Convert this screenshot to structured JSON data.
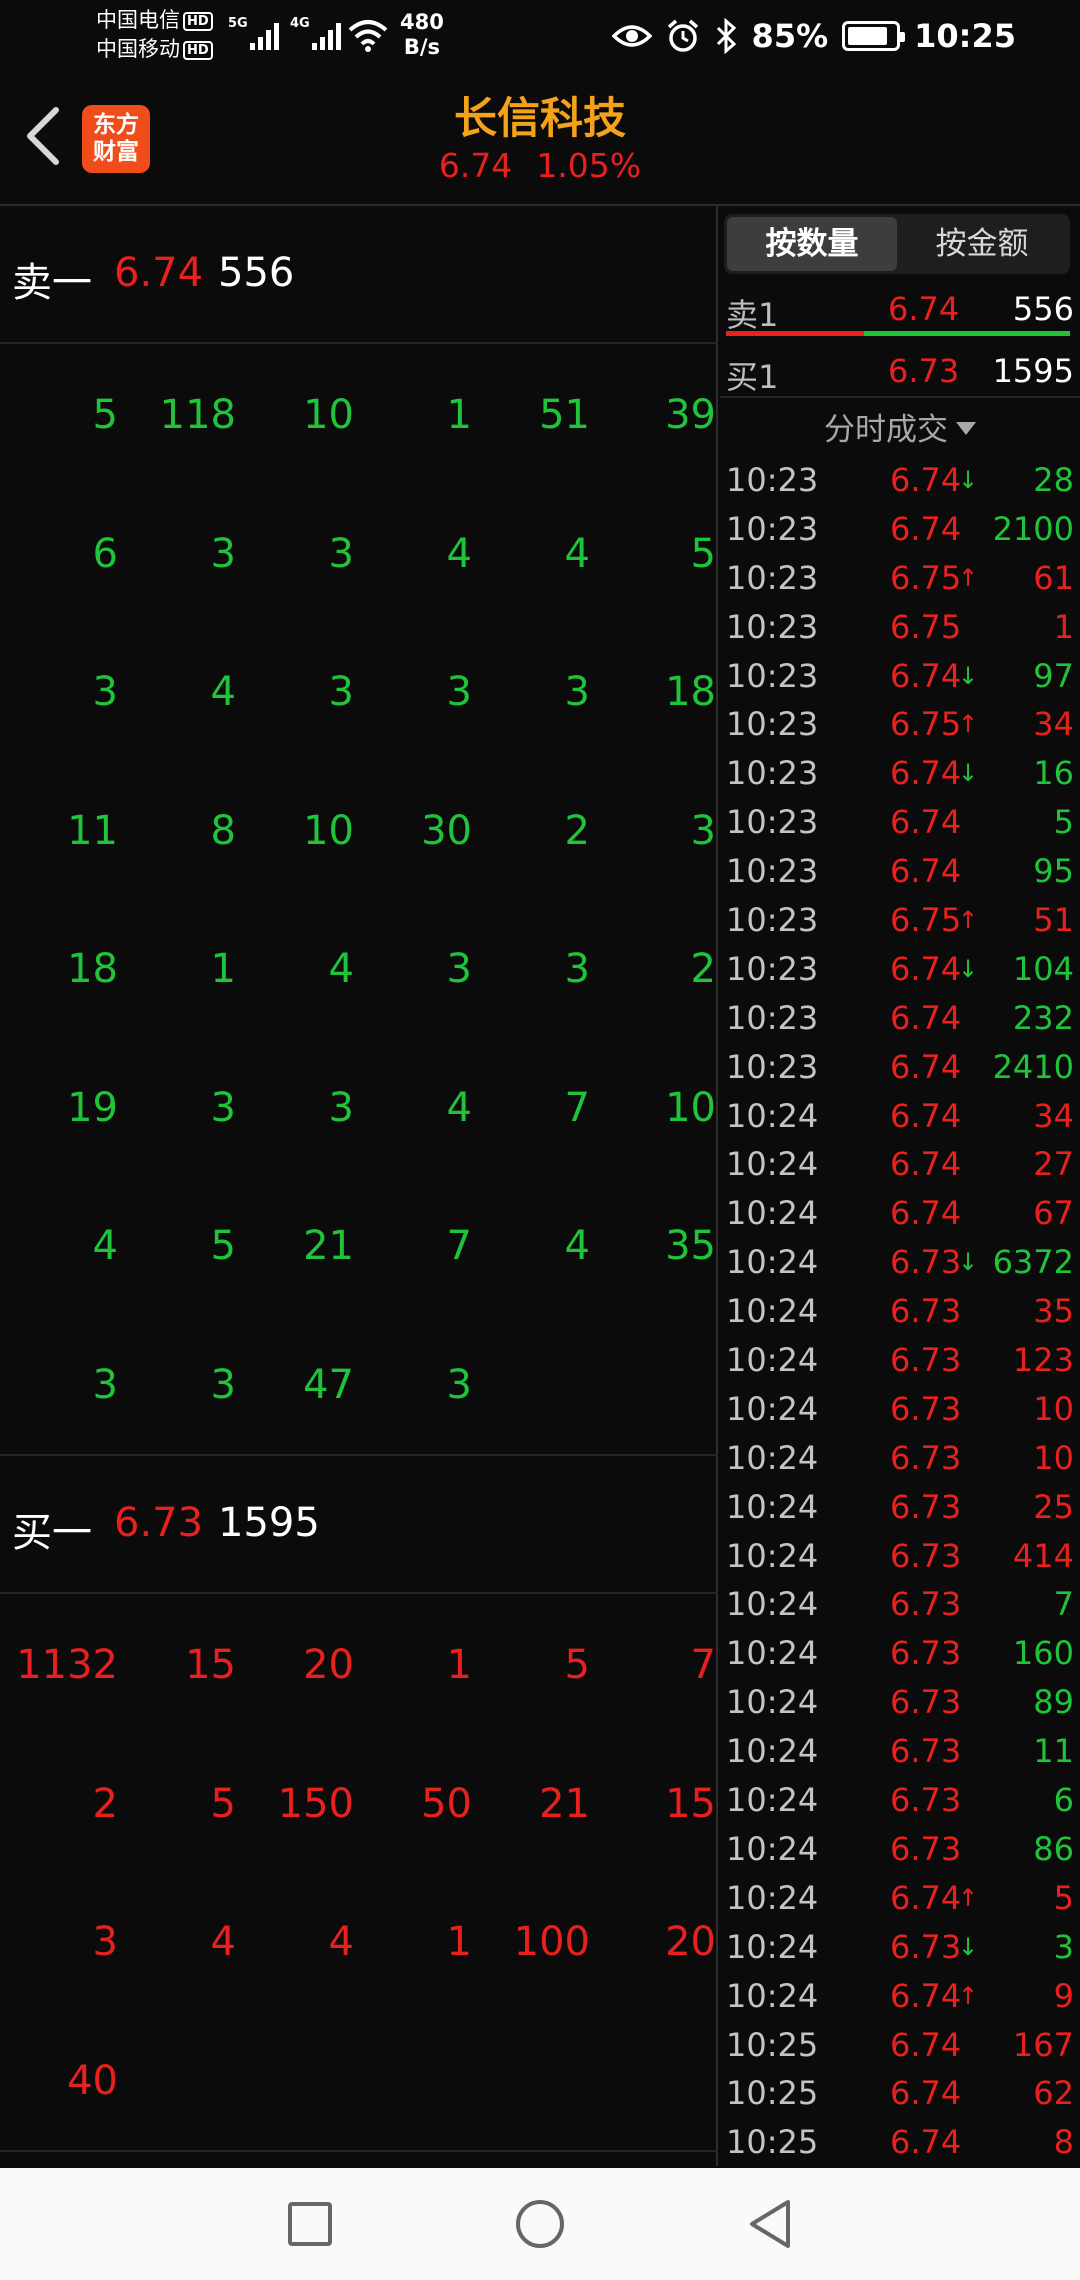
{
  "status": {
    "carrier1": "中国电信",
    "carrier2": "中国移动",
    "hd": "HD",
    "sig1": "5G",
    "sig2": "4G",
    "speed_value": "480",
    "speed_unit": "B/s",
    "battery_pct": "85%",
    "battery_level": 0.85,
    "time": "10:25"
  },
  "header": {
    "logo_line1": "东方",
    "logo_line2": "财富",
    "title": "长信科技",
    "price": "6.74",
    "change_pct": "1.05%"
  },
  "ask": {
    "label": "卖一",
    "price": "6.74",
    "volume": "556"
  },
  "ask_queue": [
    [
      "5",
      "118",
      "10",
      "1",
      "51",
      "39"
    ],
    [
      "6",
      "3",
      "3",
      "4",
      "4",
      "5"
    ],
    [
      "3",
      "4",
      "3",
      "3",
      "3",
      "18"
    ],
    [
      "11",
      "8",
      "10",
      "30",
      "2",
      "3"
    ],
    [
      "18",
      "1",
      "4",
      "3",
      "3",
      "2"
    ],
    [
      "19",
      "3",
      "3",
      "4",
      "7",
      "10"
    ],
    [
      "4",
      "5",
      "21",
      "7",
      "4",
      "35"
    ],
    [
      "3",
      "3",
      "47",
      "3",
      "",
      ""
    ]
  ],
  "bid": {
    "label": "买一",
    "price": "6.73",
    "volume": "1595"
  },
  "bid_queue": [
    [
      "1132",
      "15",
      "20",
      "1",
      "5",
      "7"
    ],
    [
      "2",
      "5",
      "150",
      "50",
      "21",
      "15"
    ],
    [
      "3",
      "4",
      "4",
      "1",
      "100",
      "20"
    ],
    [
      "40",
      "",
      "",
      "",
      "",
      ""
    ]
  ],
  "right": {
    "tab_qty": "按数量",
    "tab_amount": "按金额",
    "sell1_label": "卖1",
    "sell1_price": "6.74",
    "sell1_vol": "556",
    "buy1_label": "买1",
    "buy1_price": "6.73",
    "buy1_vol": "1595",
    "ticks_title": "分时成交"
  },
  "ticks": [
    {
      "t": "10:23",
      "p": "6.74",
      "d": "down",
      "n": "28",
      "c": "green"
    },
    {
      "t": "10:23",
      "p": "6.74",
      "d": "",
      "n": "2100",
      "c": "green"
    },
    {
      "t": "10:23",
      "p": "6.75",
      "d": "up",
      "n": "61",
      "c": "red"
    },
    {
      "t": "10:23",
      "p": "6.75",
      "d": "",
      "n": "1",
      "c": "red"
    },
    {
      "t": "10:23",
      "p": "6.74",
      "d": "down",
      "n": "97",
      "c": "green"
    },
    {
      "t": "10:23",
      "p": "6.75",
      "d": "up",
      "n": "34",
      "c": "red"
    },
    {
      "t": "10:23",
      "p": "6.74",
      "d": "down",
      "n": "16",
      "c": "green"
    },
    {
      "t": "10:23",
      "p": "6.74",
      "d": "",
      "n": "5",
      "c": "green"
    },
    {
      "t": "10:23",
      "p": "6.74",
      "d": "",
      "n": "95",
      "c": "green"
    },
    {
      "t": "10:23",
      "p": "6.75",
      "d": "up",
      "n": "51",
      "c": "red"
    },
    {
      "t": "10:23",
      "p": "6.74",
      "d": "down",
      "n": "104",
      "c": "green"
    },
    {
      "t": "10:23",
      "p": "6.74",
      "d": "",
      "n": "232",
      "c": "green"
    },
    {
      "t": "10:23",
      "p": "6.74",
      "d": "",
      "n": "2410",
      "c": "green"
    },
    {
      "t": "10:24",
      "p": "6.74",
      "d": "",
      "n": "34",
      "c": "red"
    },
    {
      "t": "10:24",
      "p": "6.74",
      "d": "",
      "n": "27",
      "c": "red"
    },
    {
      "t": "10:24",
      "p": "6.74",
      "d": "",
      "n": "67",
      "c": "red"
    },
    {
      "t": "10:24",
      "p": "6.73",
      "d": "down",
      "n": "6372",
      "c": "green"
    },
    {
      "t": "10:24",
      "p": "6.73",
      "d": "",
      "n": "35",
      "c": "red"
    },
    {
      "t": "10:24",
      "p": "6.73",
      "d": "",
      "n": "123",
      "c": "red"
    },
    {
      "t": "10:24",
      "p": "6.73",
      "d": "",
      "n": "10",
      "c": "red"
    },
    {
      "t": "10:24",
      "p": "6.73",
      "d": "",
      "n": "10",
      "c": "red"
    },
    {
      "t": "10:24",
      "p": "6.73",
      "d": "",
      "n": "25",
      "c": "red"
    },
    {
      "t": "10:24",
      "p": "6.73",
      "d": "",
      "n": "414",
      "c": "red"
    },
    {
      "t": "10:24",
      "p": "6.73",
      "d": "",
      "n": "7",
      "c": "green"
    },
    {
      "t": "10:24",
      "p": "6.73",
      "d": "",
      "n": "160",
      "c": "green"
    },
    {
      "t": "10:24",
      "p": "6.73",
      "d": "",
      "n": "89",
      "c": "green"
    },
    {
      "t": "10:24",
      "p": "6.73",
      "d": "",
      "n": "11",
      "c": "green"
    },
    {
      "t": "10:24",
      "p": "6.73",
      "d": "",
      "n": "6",
      "c": "green"
    },
    {
      "t": "10:24",
      "p": "6.73",
      "d": "",
      "n": "86",
      "c": "green"
    },
    {
      "t": "10:24",
      "p": "6.74",
      "d": "up",
      "n": "5",
      "c": "red"
    },
    {
      "t": "10:24",
      "p": "6.73",
      "d": "down",
      "n": "3",
      "c": "green"
    },
    {
      "t": "10:24",
      "p": "6.74",
      "d": "up",
      "n": "9",
      "c": "red"
    },
    {
      "t": "10:25",
      "p": "6.74",
      "d": "",
      "n": "167",
      "c": "red"
    },
    {
      "t": "10:25",
      "p": "6.74",
      "d": "",
      "n": "62",
      "c": "red"
    },
    {
      "t": "10:25",
      "p": "6.74",
      "d": "",
      "n": "8",
      "c": "red"
    }
  ],
  "colors": {
    "up": "#e8201e",
    "down": "#20c43a",
    "title": "#f3a21a",
    "logo": "#f04d1b"
  },
  "icons": {
    "back": "chevron-left-icon",
    "eye": "eye-icon",
    "alarm": "alarm-icon",
    "bluetooth": "bluetooth-icon",
    "wifi": "wifi-icon",
    "battery": "battery-icon",
    "nav_recent": "square-icon",
    "nav_home": "circle-icon",
    "nav_back": "triangle-back-icon"
  }
}
